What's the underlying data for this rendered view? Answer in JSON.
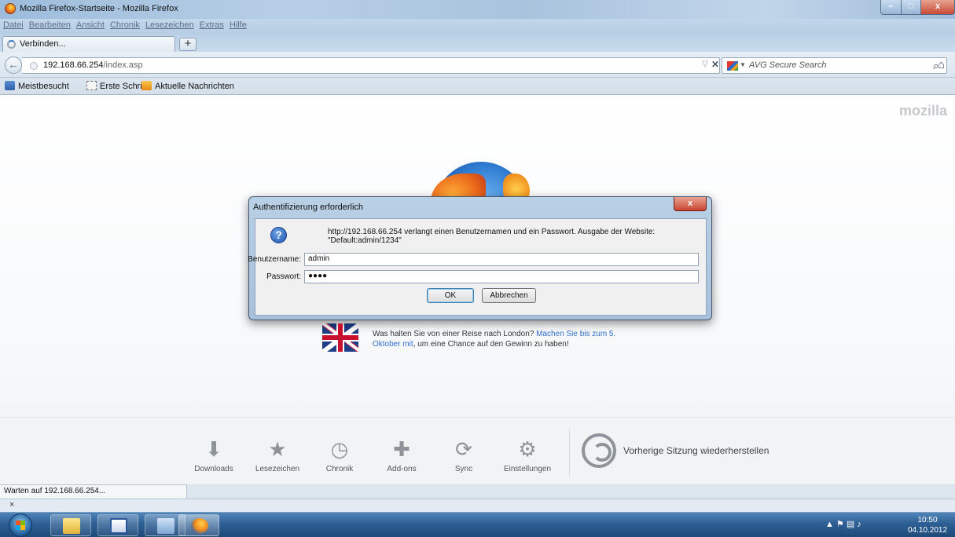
{
  "window": {
    "title": "Mozilla Firefox-Startseite - Mozilla Firefox",
    "minimize": "–",
    "maximize": "□",
    "close": "x"
  },
  "menu": [
    "Datei",
    "Bearbeiten",
    "Ansicht",
    "Chronik",
    "Lesezeichen",
    "Extras",
    "Hilfe"
  ],
  "tab": {
    "label": "Verbinden...",
    "new_tab": "+"
  },
  "nav": {
    "url_host": "192.168.66.254",
    "url_path": "/index.asp",
    "search_placeholder": "AVG Secure Search"
  },
  "bookmarks": [
    "Meistbesucht",
    "Erste Schritte",
    "Aktuelle Nachrichten"
  ],
  "content": {
    "brand": "mozilla",
    "promo_text": "Was halten Sie von einer Reise nach London?",
    "promo_link": "Machen Sie bis zum 5. Oktober mit",
    "promo_tail": ", um eine Chance auf den Gewinn zu haben!",
    "launcher": [
      "Downloads",
      "Lesezeichen",
      "Chronik",
      "Add-ons",
      "Sync",
      "Einstellungen"
    ],
    "restore": "Vorherige Sitzung wiederherstellen"
  },
  "dialog": {
    "title": "Authentifizierung erforderlich",
    "close": "x",
    "message": "http://192.168.66.254 verlangt einen Benutzernamen und ein Passwort. Ausgabe der Website: \"Default:admin/1234\"",
    "username_label": "Benutzername:",
    "username_value": "admin",
    "password_label": "Passwort:",
    "password_value": "●●●●",
    "ok": "OK",
    "cancel": "Abbrechen"
  },
  "status": {
    "text": "Warten auf 192.168.66.254...",
    "find_close": "×"
  },
  "taskbar": {
    "time": "10:50",
    "date": "04.10.2012"
  }
}
